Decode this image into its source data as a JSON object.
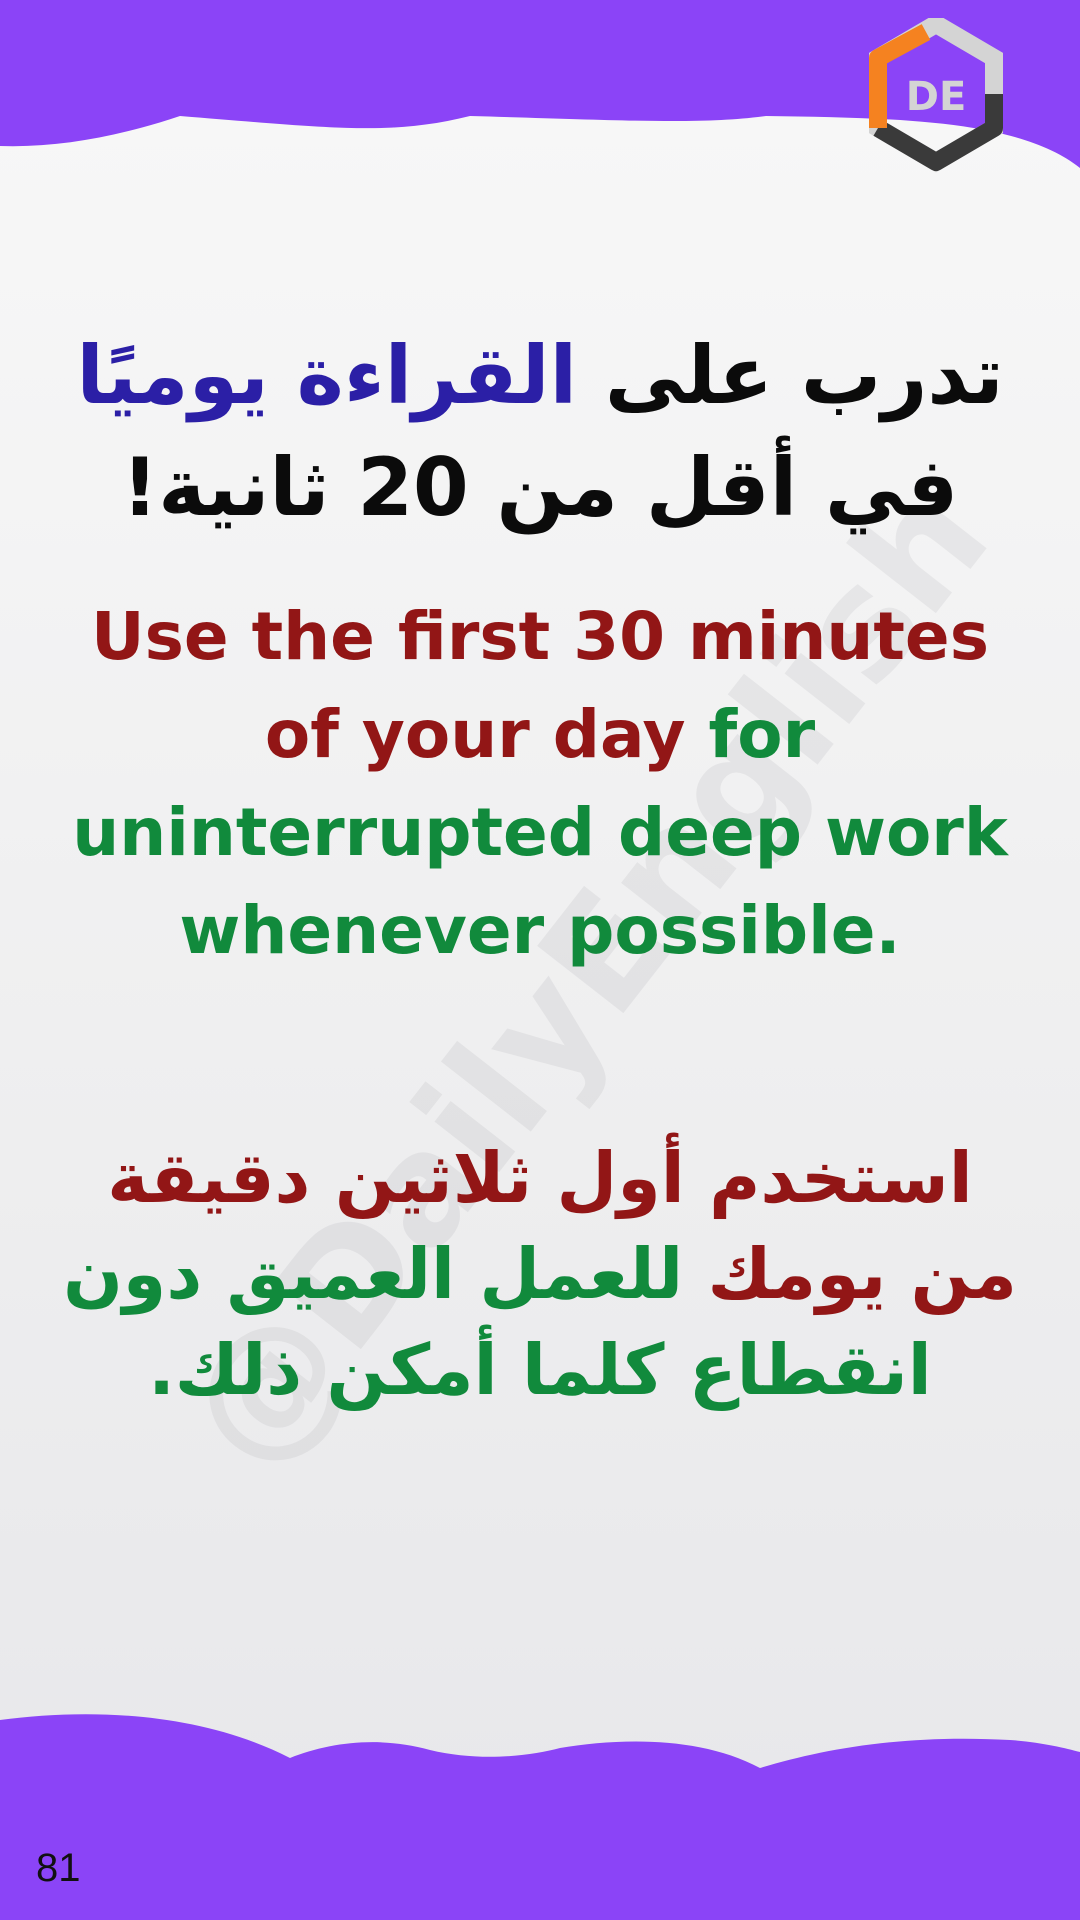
{
  "headline": {
    "part1": "تدرب على ",
    "highlight": "القراءة يوميًا",
    "part2": " في أقل من 20 ثانية!"
  },
  "english": {
    "red": "Use the first 30 minutes of your day",
    "green": "for uninterrupted deep work whenever possible."
  },
  "arabic": {
    "part1": "استخدم أول ثلاثين دقيقة من يومك",
    "part2": "للعمل العميق دون انقطاع كلما أمكن ذلك."
  },
  "watermark": "@DailyEnglish",
  "logo": {
    "text": "DE"
  },
  "page_number": "81",
  "colors": {
    "purple": "#8b44f7",
    "highlight_blue": "#2b1fa6",
    "red": "#921616",
    "green": "#118a3c",
    "logo_orange": "#f58220",
    "logo_dark": "#3a3a3a",
    "logo_gray": "#d4d4d4"
  }
}
